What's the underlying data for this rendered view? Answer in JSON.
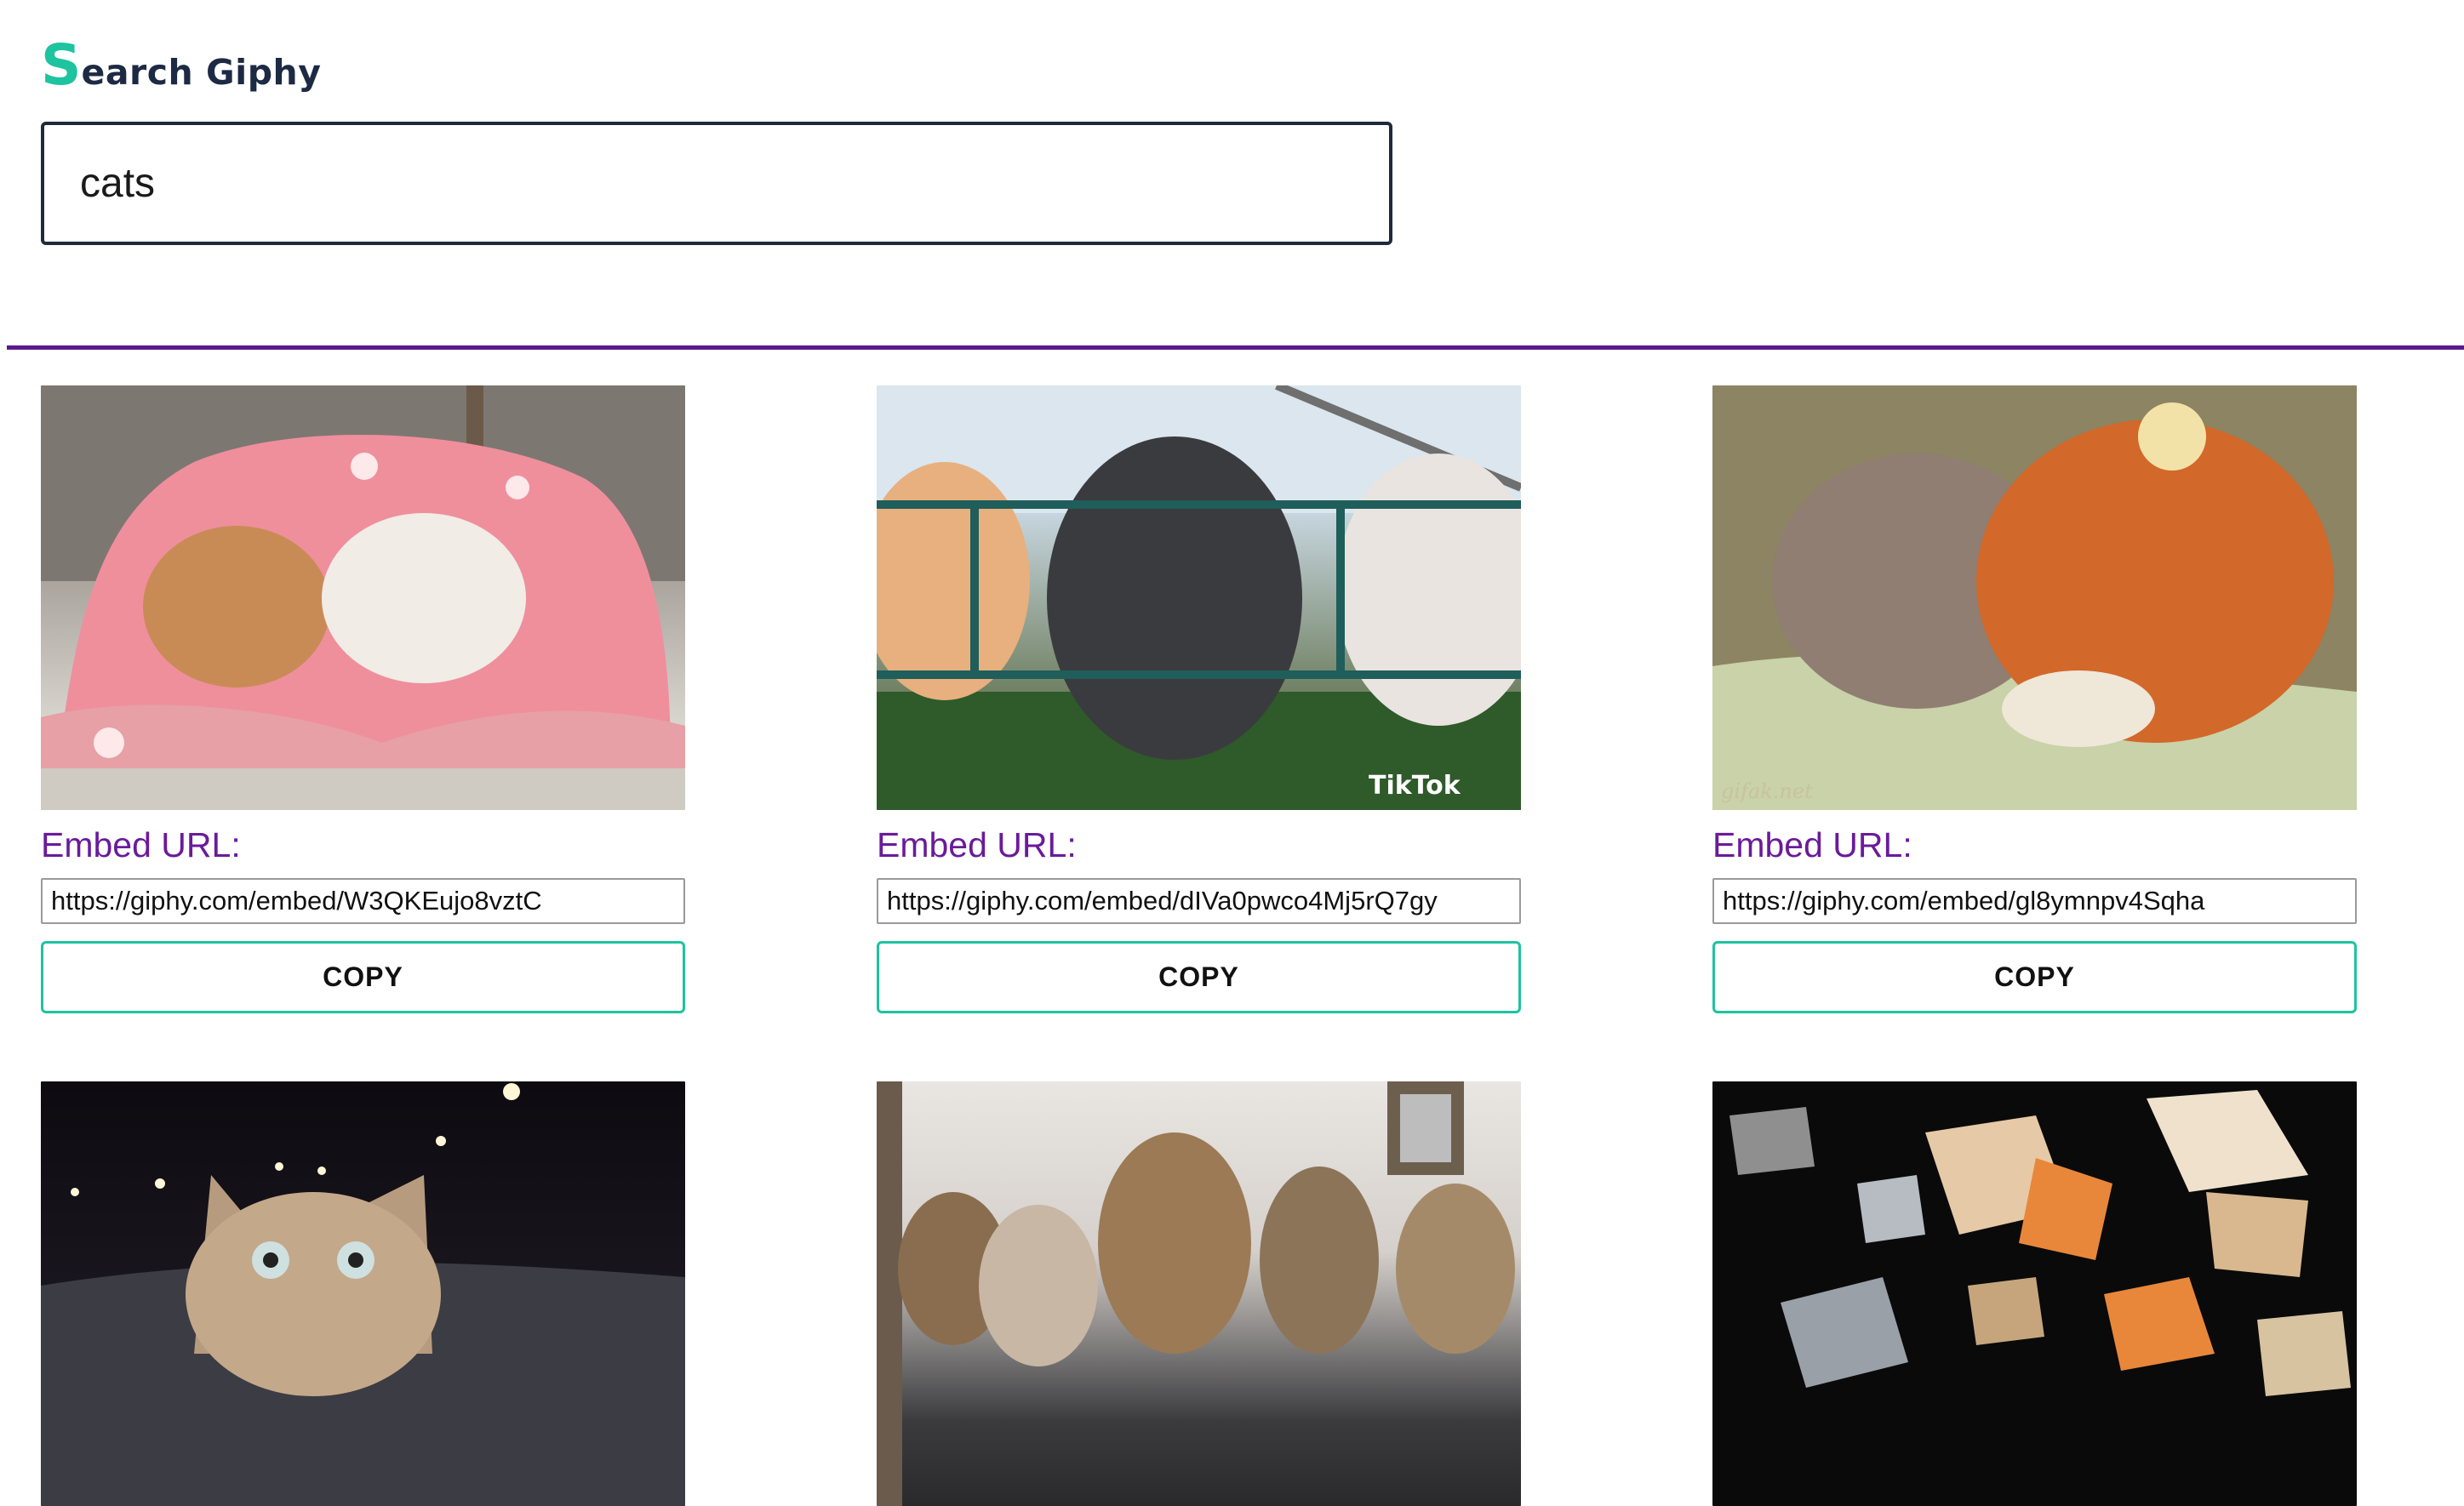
{
  "header": {
    "title_first": "S",
    "title_rest": "earch Giphy"
  },
  "search": {
    "value": "cats"
  },
  "results": [
    {
      "embed_label": "Embed URL:",
      "embed_url": "https://giphy.com/embed/W3QKEujo8vztC",
      "copy_label": "COPY"
    },
    {
      "embed_label": "Embed URL:",
      "embed_url": "https://giphy.com/embed/dIVa0pwco4Mj5rQ7gy",
      "copy_label": "COPY",
      "watermark": "TikTok"
    },
    {
      "embed_label": "Embed URL:",
      "embed_url": "https://giphy.com/embed/gl8ymnpv4Sqha",
      "copy_label": "COPY",
      "watermark": "gifak.net"
    }
  ],
  "colors": {
    "accent": "#1ec3a0",
    "title": "#1d2a44",
    "label": "#6a1b9a",
    "divider": "#5b1a8c"
  }
}
